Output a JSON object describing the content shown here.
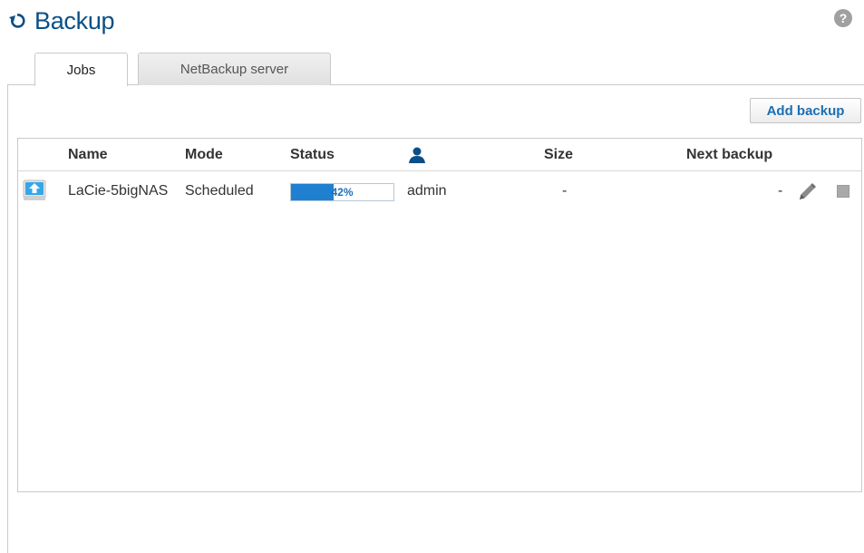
{
  "page": {
    "title": "Backup"
  },
  "tabs": [
    {
      "label": "Jobs"
    },
    {
      "label": "NetBackup server"
    }
  ],
  "toolbar": {
    "add_label": "Add backup"
  },
  "table": {
    "columns": {
      "name": "Name",
      "mode": "Mode",
      "status": "Status",
      "size": "Size",
      "next": "Next backup"
    },
    "rows": [
      {
        "name": "LaCie-5bigNAS",
        "mode": "Scheduled",
        "progress": 42,
        "progress_label": "42%",
        "user": "admin",
        "size": "-",
        "next": "-"
      }
    ]
  },
  "colors": {
    "title": "#0b4f86",
    "accent": "#1f7fd0",
    "button_text": "#1a6fb5"
  },
  "icons": [
    "refresh-icon",
    "help-icon",
    "user-icon",
    "drive-icon",
    "pencil-icon",
    "stop-icon"
  ]
}
